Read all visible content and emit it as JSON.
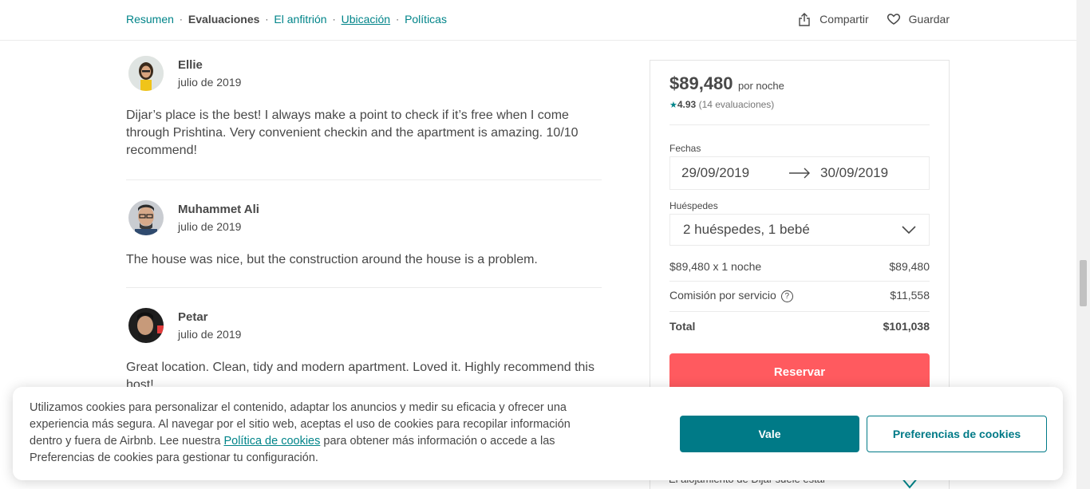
{
  "nav": {
    "links": [
      "Resumen",
      "Evaluaciones",
      "El anfitrión",
      "Ubicación",
      "Políticas"
    ],
    "share_label": "Compartir",
    "save_label": "Guardar"
  },
  "reviews": [
    {
      "name": "Ellie",
      "date": "julio de 2019",
      "text": "Dijar’s place is the best! I always make a point to check if it’s free when I come through Prishtina. Very convenient checkin and the apartment is amazing. 10/10 recommend!"
    },
    {
      "name": "Muhammet Ali",
      "date": "julio de 2019",
      "text": "The house was nice, but the construction around the house is a problem."
    },
    {
      "name": "Petar",
      "date": "julio de 2019",
      "text": "Great location. Clean, tidy and modern apartment. Loved it. Highly recommend this host!"
    }
  ],
  "booking": {
    "price": "$89,480",
    "per_night": "por noche",
    "rating_value": "4.93",
    "rating_count": "(14 evaluaciones)",
    "dates_label": "Fechas",
    "checkin": "29/09/2019",
    "checkout": "30/09/2019",
    "guests_label": "Huéspedes",
    "guests_value": "2 huéspedes, 1 bebé",
    "nightly_line_label": "$89,480 x 1 noche",
    "nightly_line_value": "$89,480",
    "service_fee_label": "Comisión por servicio",
    "service_fee_value": "$11,558",
    "total_label": "Total",
    "total_value": "$101,038",
    "reserve_label": "Reservar",
    "below_text": "El alojamiento de Dijar suele estar"
  },
  "cookie_banner": {
    "text_before": "Utilizamos cookies para personalizar el contenido, adaptar los anuncios y medir su eficacia y ofrecer una experiencia más segura. Al navegar por el sitio web, aceptas el uso de cookies para recopilar información dentro y fuera de Airbnb. Lee nuestra ",
    "link_text": "Política de cookies",
    "text_after": " para obtener más información o accede a las Preferencias de cookies para gestionar tu configuración.",
    "accept_label": "Vale",
    "prefs_label": "Preferencias de cookies"
  },
  "colors": {
    "accent": "#008489",
    "reserve": "#ff5a5f",
    "text": "#484848"
  }
}
